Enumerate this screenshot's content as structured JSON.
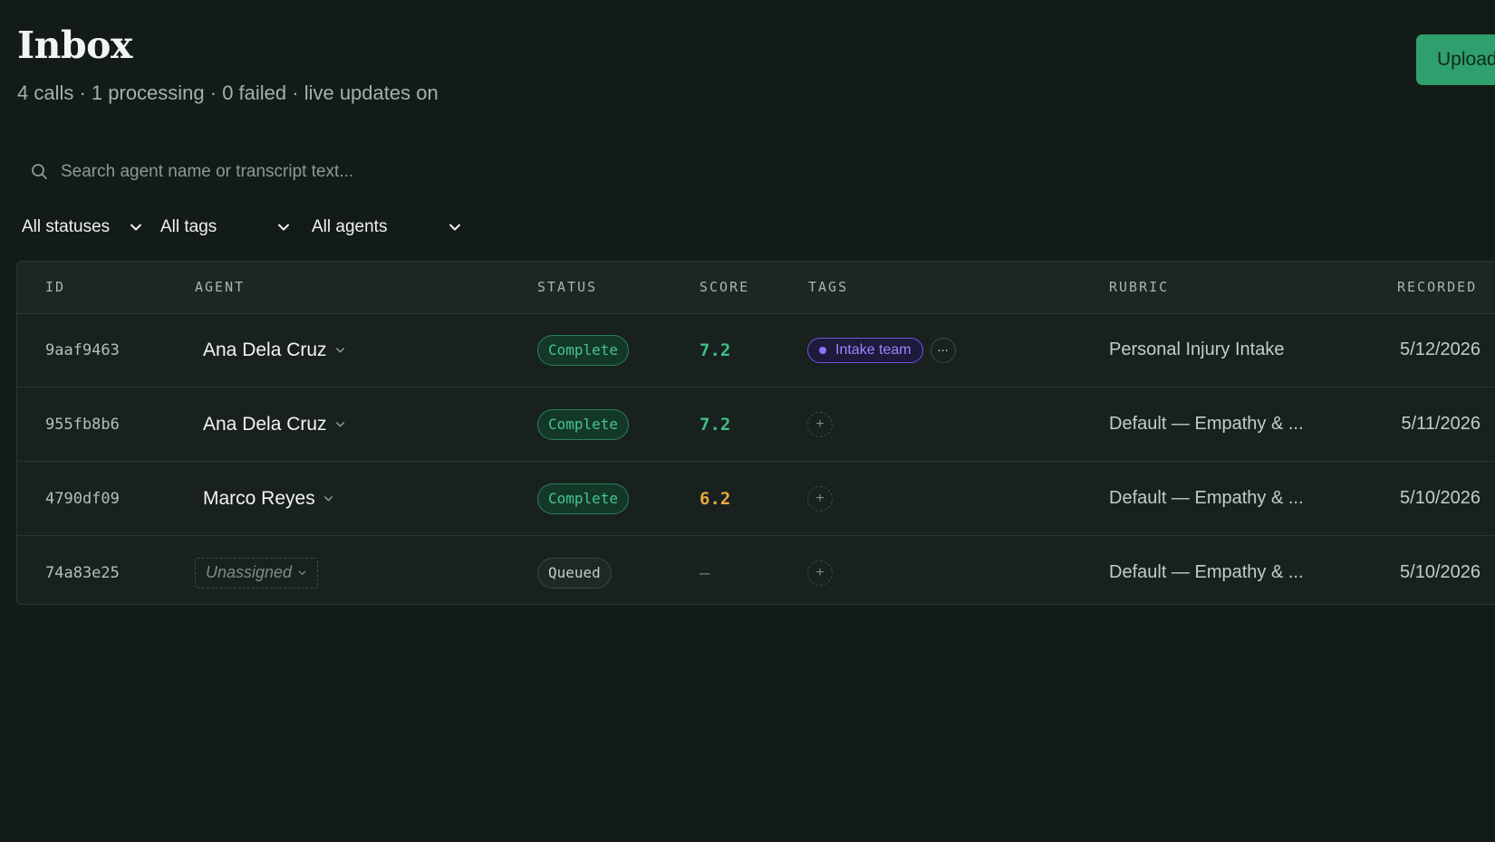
{
  "header": {
    "title": "Inbox",
    "subtitle": "4 calls · 1 processing · 0 failed · live updates on",
    "upload_label": "Upload"
  },
  "search": {
    "placeholder": "Search agent name or transcript text...",
    "value": ""
  },
  "filters": {
    "status": "All statuses",
    "tags": "All tags",
    "agents": "All agents"
  },
  "table": {
    "columns": [
      "ID",
      "AGENT",
      "STATUS",
      "SCORE",
      "TAGS",
      "RUBRIC",
      "RECORDED"
    ],
    "rows": [
      {
        "id": "9aaf9463",
        "agent": "Ana Dela Cruz",
        "status": "Complete",
        "score": "7.2",
        "tag": "Intake team",
        "more": "...",
        "rubric": "Personal Injury Intake",
        "recorded": "5/12/2026"
      },
      {
        "id": "955fb8b6",
        "agent": "Ana Dela Cruz",
        "status": "Complete",
        "score": "7.2",
        "add_tag": "+",
        "rubric": "Default — Empathy & ...",
        "recorded": "5/11/2026"
      },
      {
        "id": "4790df09",
        "agent": "Marco Reyes",
        "status": "Complete",
        "score": "6.2",
        "add_tag": "+",
        "rubric": "Default — Empathy & ...",
        "recorded": "5/10/2026"
      },
      {
        "id": "74a83e25",
        "agent": "Unassigned",
        "status": "Queued",
        "score": "–",
        "add_tag": "+",
        "rubric": "Default — Empathy & ...",
        "recorded": "5/10/2026"
      }
    ]
  },
  "colors": {
    "background": "#131b18",
    "accent": "#2f9f6d",
    "score_good": "#3fbf86",
    "score_mid": "#e6a83c",
    "tag_purple": "#8b73ff"
  },
  "icons": {
    "search": "search-icon",
    "dropdown": "chevron-down-icon",
    "tag_dot": "dot-icon",
    "add_tag": "plus-icon"
  }
}
